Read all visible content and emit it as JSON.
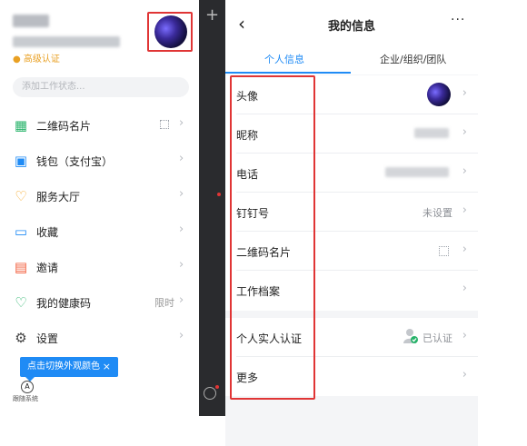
{
  "left_panel": {
    "certification": "高级认证",
    "status_placeholder": "添加工作状态...",
    "menu": [
      {
        "label": "二维码名片",
        "icon": "qr-icon",
        "color": "#27b36a"
      },
      {
        "label": "钱包（支付宝）",
        "icon": "wallet-icon",
        "color": "#1f8bf5"
      },
      {
        "label": "服务大厅",
        "icon": "heart-icon",
        "color": "#f5a623"
      },
      {
        "label": "收藏",
        "icon": "favorite-box-icon",
        "color": "#1f8bf5"
      },
      {
        "label": "邀请",
        "icon": "invite-icon",
        "color": "#f25c3a"
      },
      {
        "label": "我的健康码",
        "icon": "health-icon",
        "color": "#27b36a",
        "badge": "限时"
      },
      {
        "label": "设置",
        "icon": "settings-icon",
        "color": "#444444"
      }
    ],
    "tooltip": "点击切换外观颜色",
    "tooltip_close": "×",
    "system_label": "跟随系统"
  },
  "strip": {
    "plus": "+"
  },
  "right_panel": {
    "back": "‹",
    "title": "我的信息",
    "more": "···",
    "tabs": [
      "个人信息",
      "企业/组织/团队"
    ],
    "rows": [
      {
        "key": "头像"
      },
      {
        "key": "昵称"
      },
      {
        "key": "电话"
      },
      {
        "key": "钉钉号",
        "value": "未设置"
      },
      {
        "key": "二维码名片"
      },
      {
        "key": "工作档案"
      },
      {
        "key": "个人实人认证",
        "value": "已认证"
      },
      {
        "key": "更多"
      }
    ]
  },
  "colors": {
    "accent": "#1f8bf5",
    "highlight_box": "#e03535"
  }
}
